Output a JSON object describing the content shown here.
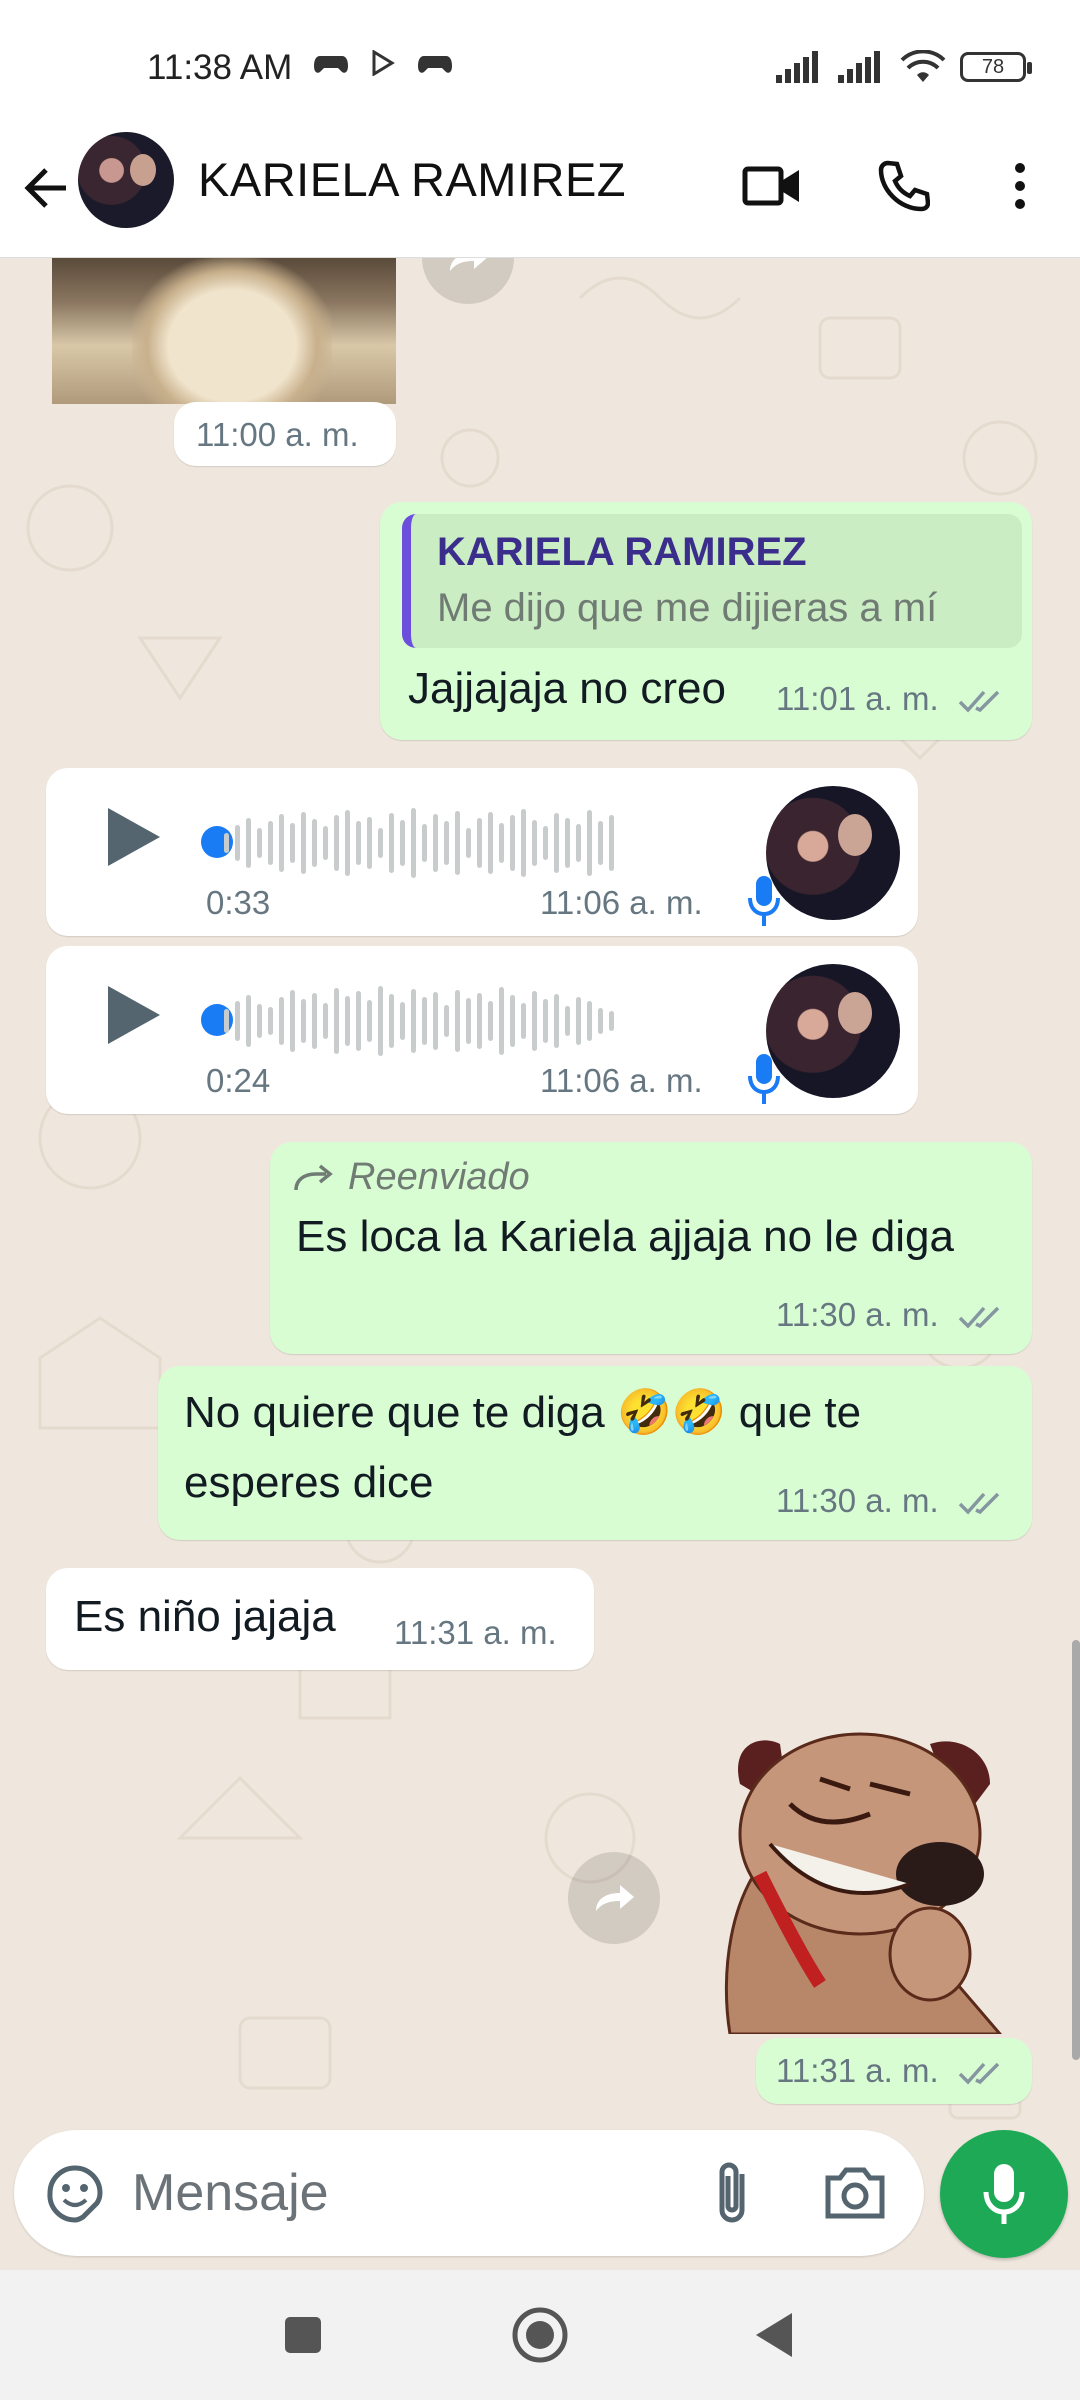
{
  "status_bar": {
    "time": "11:38 AM",
    "battery": "78"
  },
  "header": {
    "contact_name": "KARIELA RAMIREZ"
  },
  "messages": [
    {
      "type": "image",
      "direction": "in",
      "time": "11:00 a. m."
    },
    {
      "type": "reply",
      "direction": "out",
      "quoted_name": "KARIELA RAMIREZ",
      "quoted_text": "Me dijo que me dijieras a mí",
      "text": "Jajjajaja no creo",
      "time": "11:01 a. m."
    },
    {
      "type": "voice",
      "direction": "in",
      "duration": "0:33",
      "time": "11:06 a. m."
    },
    {
      "type": "voice",
      "direction": "in",
      "duration": "0:24",
      "time": "11:06 a. m."
    },
    {
      "type": "forwarded",
      "direction": "out",
      "forward_label": "Reenviado",
      "text": "Es loca la Kariela ajjaja no le diga",
      "time": "11:30 a. m."
    },
    {
      "type": "text",
      "direction": "out",
      "text_line1": "No quiere que te diga 🤣🤣 que te",
      "text_line2": "esperes dice",
      "time": "11:30 a. m."
    },
    {
      "type": "text",
      "direction": "in",
      "text": "Es niño jajaja",
      "time": "11:31 a. m."
    },
    {
      "type": "sticker",
      "direction": "out",
      "time": "11:31 a. m."
    }
  ],
  "composer": {
    "placeholder": "Mensaje"
  },
  "icons": {
    "back": "arrow-left-icon",
    "video": "video-call-icon",
    "call": "phone-icon",
    "menu": "more-vert-icon",
    "emoji": "sticker-icon",
    "attach": "paperclip-icon",
    "camera": "camera-icon",
    "mic": "mic-icon"
  },
  "colors": {
    "outgoing_bubble": "#d9fdd3",
    "incoming_bubble": "#ffffff",
    "chat_background": "#efe7dd",
    "accent_green": "#1da955",
    "voice_dot": "#1a7cf5",
    "quote_bar": "#6b4fdc"
  }
}
